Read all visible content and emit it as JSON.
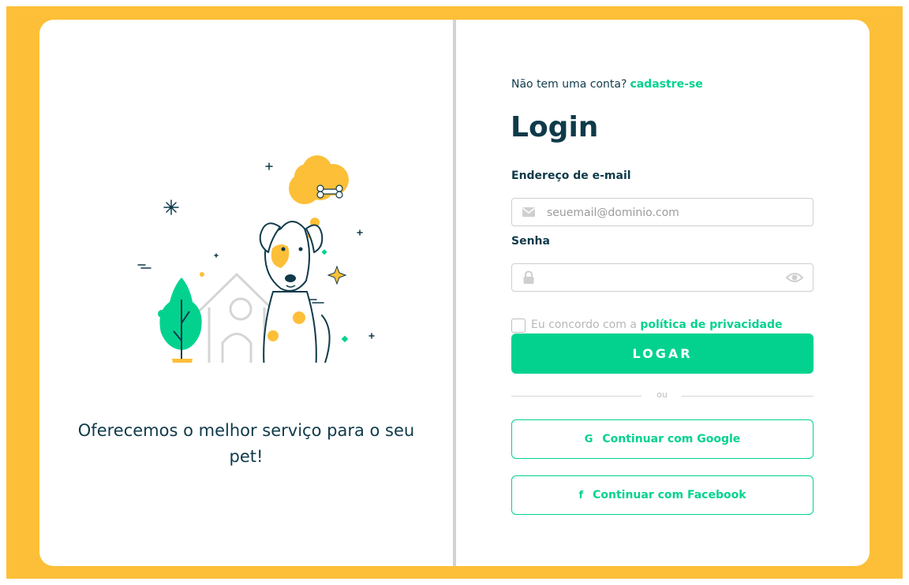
{
  "left_panel": {
    "tagline": "Oferecemos o melhor serviço para o seu pet!"
  },
  "signup": {
    "prompt": "Não tem uma conta?",
    "link": "cadastre-se"
  },
  "login": {
    "title": "Login",
    "email_label": "Endereço de e-mail",
    "email_placeholder": "seuemail@dominio.com",
    "email_value": "",
    "password_label": "Senha",
    "password_value": "",
    "agree_text": "Eu concordo com a",
    "privacy_link": "política de privacidade",
    "agree_checked": false,
    "submit": "LOGAR",
    "separator": "ou",
    "google_button": "Continuar com Google",
    "google_glyph": "G",
    "facebook_button": "Continuar com Facebook",
    "facebook_glyph": "f"
  },
  "icons": {
    "email": "envelope-icon",
    "password": "lock-icon",
    "show_password": "eye-icon",
    "google": "google-icon",
    "facebook": "facebook-icon"
  },
  "colors": {
    "frame": "#fdbf38",
    "accent": "#03d28f",
    "text_dark": "#0f3a4a",
    "divider": "#d3d3d3"
  }
}
